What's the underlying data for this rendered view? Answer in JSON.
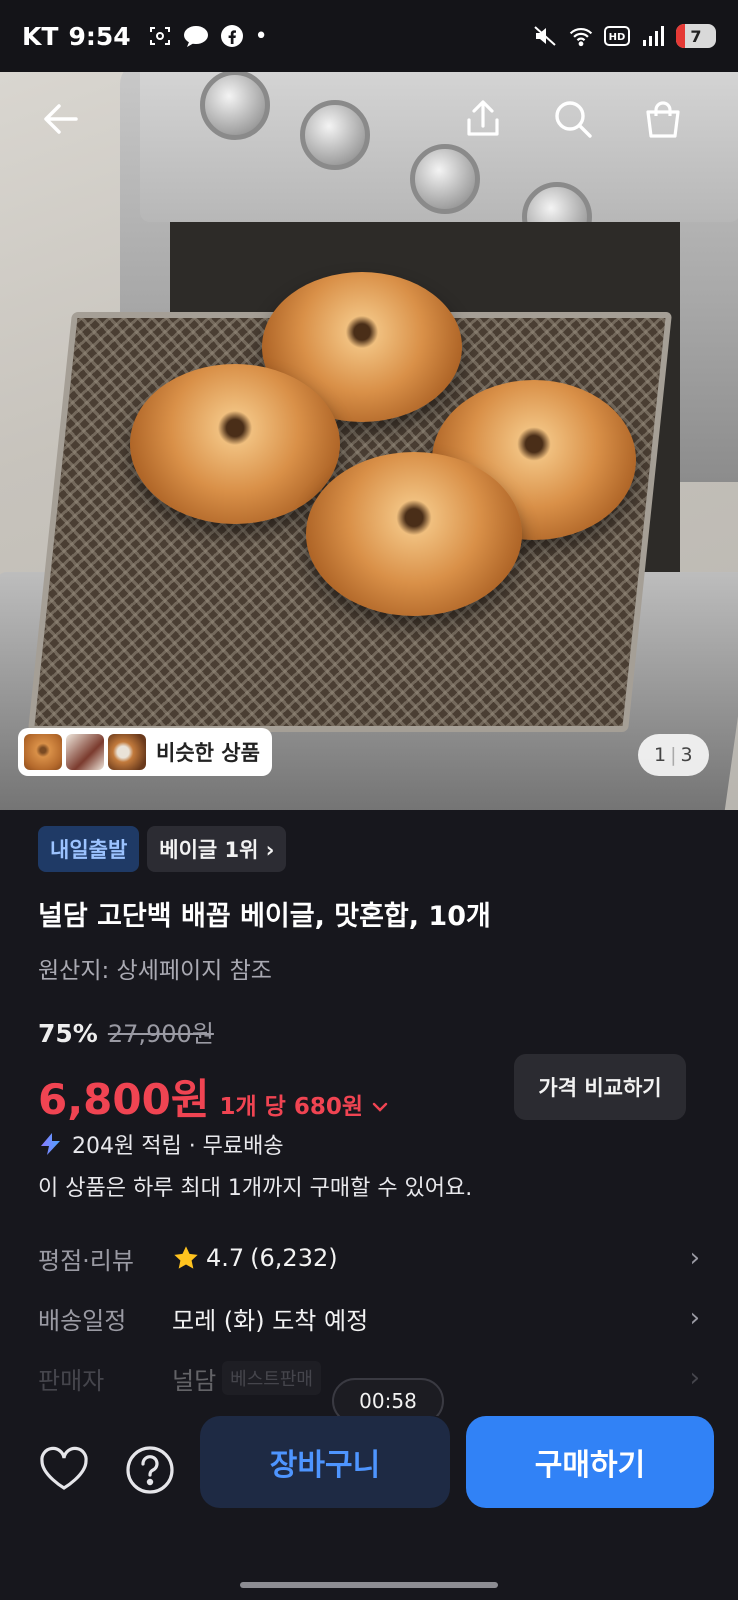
{
  "status_bar": {
    "carrier": "KT",
    "time": "9:54",
    "battery": "7"
  },
  "gallery": {
    "similar_label": "비슷한 상품",
    "page_current": "1",
    "page_total": "3"
  },
  "badges": {
    "delivery": "내일출발",
    "rank": "베이글 1위 ›"
  },
  "product": {
    "title": "널담 고단백 배꼽 베이글, 맛혼합, 10개",
    "origin": "원산지: 상세페이지 참조",
    "discount": "75%",
    "original_price": "27,900원",
    "price": "6,800원",
    "unit_price": "1개 당 680원",
    "compare_label": "가격 비교하기",
    "reward": "204원 적립 · 무료배송",
    "purchase_limit": "이 상품은 하루 최대 1개까지 구매할 수 있어요."
  },
  "info": {
    "rating_key": "평점·리뷰",
    "rating_value": "4.7",
    "review_count": "(6,232)",
    "shipping_key": "배송일정",
    "shipping_value": "모레 (화) 도착 예정",
    "seller_key": "판매자",
    "seller_value": "널담",
    "seller_badge": "베스트판매",
    "timer": "00:58"
  },
  "actions": {
    "cart": "장바구니",
    "buy": "구매하기"
  },
  "colors": {
    "price_red": "#f04452",
    "buy_blue": "#3182f6",
    "cart_text_blue": "#4e95ff"
  }
}
